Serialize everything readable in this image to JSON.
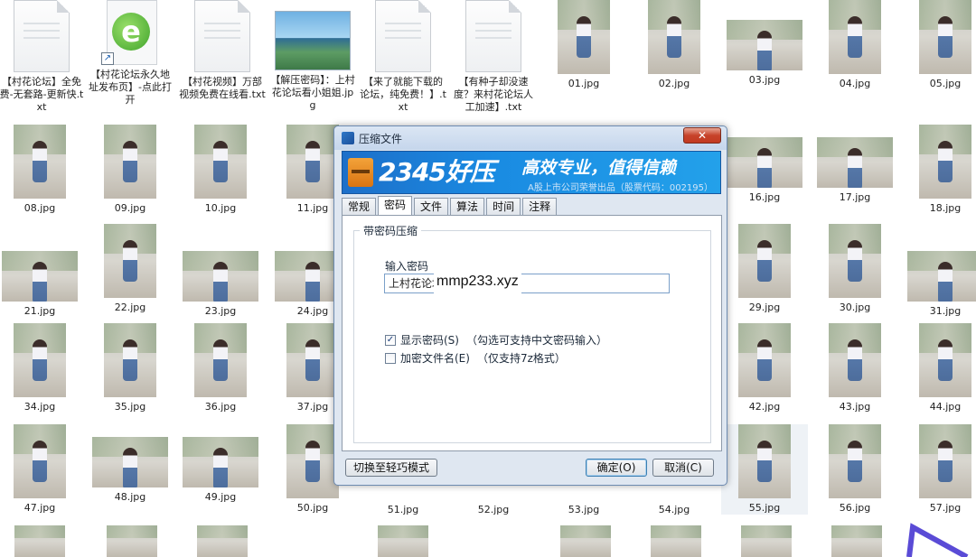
{
  "desktop_files": {
    "f1": "【村花论坛】全免费-无套路-更新快.txt",
    "f2": "【村花论坛永久地址发布页】-点此打开",
    "f3": "【村花视频】万部视频免费在线看.txt",
    "f4": "【解压密码】：上村花论坛看小姐姐.jpg",
    "f5": "【来了就能下载的论坛，纯免费！】.txt",
    "f6": "【有种子却没速度？来村花论坛人工加速】.txt",
    "photos_row1": [
      "01.jpg",
      "02.jpg",
      "03.jpg",
      "04.jpg",
      "05.jpg"
    ],
    "photos_row2": [
      "08.jpg",
      "09.jpg",
      "10.jpg",
      "11.jpg",
      "16.jpg",
      "17.jpg",
      "18.jpg"
    ],
    "photos_row3": [
      "21.jpg",
      "22.jpg",
      "23.jpg",
      "24.jpg",
      "29.jpg",
      "30.jpg",
      "31.jpg"
    ],
    "photos_row4": [
      "34.jpg",
      "35.jpg",
      "36.jpg",
      "37.jpg",
      "42.jpg",
      "43.jpg",
      "44.jpg"
    ],
    "photos_row5": [
      "47.jpg",
      "48.jpg",
      "49.jpg",
      "50.jpg",
      "51.jpg",
      "52.jpg",
      "53.jpg",
      "54.jpg",
      "55.jpg",
      "56.jpg",
      "57.jpg"
    ]
  },
  "dialog": {
    "title": "压缩文件",
    "close": "✕",
    "banner": {
      "brand": "2345好压",
      "slogan": "高效专业，值得信赖",
      "sub": "A股上市公司荣誉出品（股票代码：002195）"
    },
    "tabs": [
      "常规",
      "密码",
      "文件",
      "算法",
      "时间",
      "注释"
    ],
    "group_title": "带密码压缩",
    "password_label": "输入密码",
    "password_value": "上村花论坛",
    "password_overlay": "mmp233.xyz",
    "show_password_label": "显示密码(S)",
    "show_password_hint": "（勾选可支持中文密码输入）",
    "show_password_checked": "✓",
    "encrypt_names_label": "加密文件名(E)",
    "encrypt_names_hint": "（仅支持7z格式）",
    "easy_mode_button": "切换至轻巧模式",
    "ok_button": "确定(O)",
    "cancel_button": "取消(C)"
  }
}
